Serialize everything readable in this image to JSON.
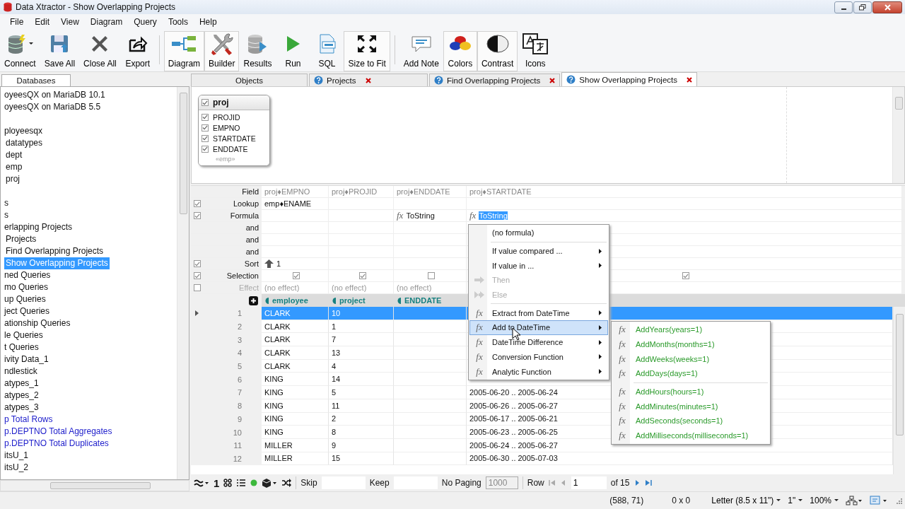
{
  "window": {
    "title": "Data Xtractor - Show Overlapping Projects"
  },
  "menu": [
    "File",
    "Edit",
    "View",
    "Diagram",
    "Query",
    "Tools",
    "Help"
  ],
  "toolbar": [
    [
      {
        "label": "Connect",
        "on": false,
        "dropdown": true
      },
      {
        "label": "Save All",
        "on": false,
        "dropdown": false
      },
      {
        "label": "Close All",
        "on": false,
        "dropdown": false
      },
      {
        "label": "Export",
        "on": false,
        "dropdown": false
      }
    ],
    [
      {
        "label": "Diagram",
        "on": true,
        "dropdown": false
      },
      {
        "label": "Builder",
        "on": true,
        "dropdown": false
      },
      {
        "label": "Results",
        "on": false,
        "dropdown": false
      },
      {
        "label": "Run",
        "on": false,
        "dropdown": false
      },
      {
        "label": "SQL",
        "on": false,
        "dropdown": false
      },
      {
        "label": "Size to Fit",
        "on": true,
        "dropdown": false
      }
    ],
    [
      {
        "label": "Add Note",
        "on": false,
        "dropdown": false
      },
      {
        "label": "Colors",
        "on": true,
        "dropdown": false
      },
      {
        "label": "Contrast",
        "on": true,
        "dropdown": false
      },
      {
        "label": "Icons",
        "on": false,
        "dropdown": false
      }
    ]
  ],
  "sidebar": {
    "tab": "Databases",
    "sections": [
      [
        {
          "label": "oyeesQX on MariaDB 10.1",
          "kind": "plain",
          "selected": false
        },
        {
          "label": "oyeesQX on MariaDB 5.5",
          "kind": "plain",
          "selected": false
        }
      ],
      [
        {
          "label": "ployeesqx",
          "kind": "plain",
          "selected": false,
          "children": [
            {
              "label": "datatypes",
              "kind": "plain",
              "selected": false
            },
            {
              "label": "dept",
              "kind": "plain",
              "selected": false
            },
            {
              "label": "emp",
              "kind": "plain",
              "selected": false
            },
            {
              "label": "proj",
              "kind": "plain",
              "selected": false
            }
          ]
        }
      ],
      [
        {
          "label": "s",
          "kind": "plain",
          "selected": false
        },
        {
          "label": "s",
          "kind": "plain",
          "selected": false
        },
        {
          "label": "erlapping Projects",
          "kind": "plain",
          "selected": false,
          "children": [
            {
              "label": "Projects",
              "kind": "plain",
              "selected": false
            },
            {
              "label": "Find Overlapping Projects",
              "kind": "plain",
              "selected": false
            },
            {
              "label": "Show Overlapping Projects",
              "kind": "plain",
              "selected": true
            }
          ]
        },
        {
          "label": "ned Queries",
          "kind": "plain",
          "selected": false
        },
        {
          "label": "mo Queries",
          "kind": "plain",
          "selected": false
        },
        {
          "label": "up Queries",
          "kind": "plain",
          "selected": false
        },
        {
          "label": "ject Queries",
          "kind": "plain",
          "selected": false
        },
        {
          "label": "ationship Queries",
          "kind": "plain",
          "selected": false
        },
        {
          "label": "le Queries",
          "kind": "plain",
          "selected": false
        },
        {
          "label": "t Queries",
          "kind": "plain",
          "selected": false
        },
        {
          "label": "ivity Data_1",
          "kind": "plain",
          "selected": false
        },
        {
          "label": "ndlestick",
          "kind": "plain",
          "selected": false
        },
        {
          "label": "atypes_1",
          "kind": "plain",
          "selected": false
        },
        {
          "label": "atypes_2",
          "kind": "plain",
          "selected": false
        },
        {
          "label": "atypes_3",
          "kind": "plain",
          "selected": false
        },
        {
          "label": "p Total Rows",
          "kind": "total",
          "selected": false
        },
        {
          "label": "p.DEPTNO Total Aggregates",
          "kind": "total",
          "selected": false
        },
        {
          "label": "p.DEPTNO Total Duplicates",
          "kind": "total",
          "selected": false
        },
        {
          "label": "itsU_1",
          "kind": "plain",
          "selected": false
        },
        {
          "label": "itsU_2",
          "kind": "plain",
          "selected": false
        }
      ]
    ]
  },
  "tabs": [
    {
      "label": "Objects",
      "selected": false,
      "closable": false
    },
    {
      "label": "Projects",
      "selected": false,
      "closable": true
    },
    {
      "label": "Find Overlapping Projects",
      "selected": false,
      "closable": true
    },
    {
      "label": "Show Overlapping Projects",
      "selected": true,
      "closable": true
    }
  ],
  "diagram": {
    "table": {
      "name": "proj",
      "checked": true,
      "fields": [
        {
          "name": "PROJID",
          "checked": true
        },
        {
          "name": "EMPNO",
          "checked": true
        },
        {
          "name": "STARTDATE",
          "checked": true
        },
        {
          "name": "ENDDATE",
          "checked": true
        }
      ],
      "footer": "«emp»"
    }
  },
  "query_grid": {
    "rows": [
      {
        "label": "Field",
        "kind": "header",
        "disabled": false,
        "cells": [
          {
            "text": "proj♦EMPNO"
          },
          {
            "text": "proj♦PROJID"
          },
          {
            "text": "proj♦ENDDATE"
          },
          {
            "text": "proj♦STARTDATE"
          }
        ]
      },
      {
        "label": "Lookup",
        "kind": "text",
        "checked": true,
        "disabled": false,
        "cells": [
          {
            "text": "emp♦ENAME"
          },
          {},
          {},
          {}
        ]
      },
      {
        "label": "Formula",
        "kind": "formula",
        "checked": true,
        "disabled": false,
        "cells": [
          {},
          {},
          {
            "glyph": "fx",
            "text": "ToString",
            "selected": false
          },
          {
            "glyph": "fx",
            "text": "ToString",
            "selected": true
          }
        ]
      },
      {
        "label": "and",
        "kind": "text",
        "disabled": false,
        "cells": [
          {},
          {},
          {},
          {}
        ]
      },
      {
        "label": "and",
        "kind": "text",
        "disabled": false,
        "cells": [
          {},
          {},
          {},
          {}
        ]
      },
      {
        "label": "and",
        "kind": "text",
        "disabled": false,
        "cells": [
          {},
          {},
          {},
          {}
        ]
      },
      {
        "label": "Sort",
        "kind": "sort",
        "checked": true,
        "disabled": false,
        "cells": [
          {
            "text": "1",
            "ascending": true
          },
          {},
          {},
          {}
        ]
      },
      {
        "label": "Selection",
        "kind": "checkbox",
        "checked": true,
        "disabled": false,
        "cells": [
          {
            "checked": true
          },
          {
            "checked": true
          },
          {
            "checked": false
          },
          {
            "checked": true
          }
        ]
      },
      {
        "label": "Effect",
        "kind": "muted",
        "checked": false,
        "disabled": true,
        "cells": [
          {
            "text": "(no effect)"
          },
          {
            "text": "(no effect)"
          },
          {
            "text": "(no effect)"
          },
          {}
        ]
      }
    ]
  },
  "results": {
    "columns": [
      "employee",
      "project",
      "ENDDATE"
    ],
    "rows": [
      {
        "n": "1",
        "employee": "CLARK",
        "project": "10",
        "selected": true
      },
      {
        "n": "2",
        "employee": "CLARK",
        "project": "1",
        "selected": false
      },
      {
        "n": "3",
        "employee": "CLARK",
        "project": "7",
        "selected": false
      },
      {
        "n": "4",
        "employee": "CLARK",
        "project": "13",
        "selected": false
      },
      {
        "n": "5",
        "employee": "CLARK",
        "project": "4",
        "selected": false
      },
      {
        "n": "6",
        "employee": "KING",
        "project": "14",
        "selected": false
      },
      {
        "n": "7",
        "employee": "KING",
        "project": "5",
        "startdate": "2005-06-20 .. 2005-06-24",
        "selected": false
      },
      {
        "n": "8",
        "employee": "KING",
        "project": "11",
        "startdate": "2005-06-26 .. 2005-06-27",
        "selected": false
      },
      {
        "n": "9",
        "employee": "KING",
        "project": "2",
        "startdate": "2005-06-17 .. 2005-06-21",
        "selected": false
      },
      {
        "n": "10",
        "employee": "KING",
        "project": "8",
        "startdate": "2005-06-23 .. 2005-06-25",
        "selected": false
      },
      {
        "n": "11",
        "employee": "MILLER",
        "project": "9",
        "startdate": "2005-06-24 .. 2005-06-27",
        "selected": false
      },
      {
        "n": "12",
        "employee": "MILLER",
        "project": "15",
        "startdate": "2005-06-30 .. 2005-07-03",
        "selected": false
      }
    ]
  },
  "context_menu": {
    "items": [
      {
        "kind": "plain",
        "label": "(no formula)",
        "submenu": false,
        "disabled": false,
        "selected": false
      },
      {
        "kind": "separator"
      },
      {
        "kind": "plain",
        "label": "If value compared ...",
        "submenu": true,
        "disabled": false,
        "selected": false
      },
      {
        "kind": "plain",
        "label": "If value in ...",
        "submenu": true,
        "disabled": false,
        "selected": false
      },
      {
        "kind": "then",
        "label": "Then",
        "submenu": false,
        "disabled": true,
        "selected": false
      },
      {
        "kind": "else",
        "label": "Else",
        "submenu": false,
        "disabled": true,
        "selected": false
      },
      {
        "kind": "separator"
      },
      {
        "kind": "function",
        "glyph": "fx",
        "label": "Extract from DateTime",
        "submenu": true,
        "disabled": false,
        "selected": false
      },
      {
        "kind": "function",
        "glyph": "fx",
        "label": "Add to DateTime",
        "submenu": true,
        "disabled": false,
        "selected": true
      },
      {
        "kind": "function",
        "glyph": "fx",
        "label": "DateTime Difference",
        "submenu": true,
        "disabled": false,
        "selected": false
      },
      {
        "kind": "function",
        "glyph": "fx",
        "label": "Conversion Function",
        "submenu": true,
        "disabled": false,
        "selected": false
      },
      {
        "kind": "function",
        "glyph": "fx",
        "label": "Analytic Function",
        "submenu": true,
        "disabled": false,
        "selected": false
      }
    ],
    "submenu": [
      {
        "kind": "function",
        "glyph": "fx",
        "label": "AddYears(years=1)"
      },
      {
        "kind": "function",
        "glyph": "fx",
        "label": "AddMonths(months=1)"
      },
      {
        "kind": "function",
        "glyph": "fx",
        "label": "AddWeeks(weeks=1)"
      },
      {
        "kind": "function",
        "glyph": "fx",
        "label": "AddDays(days=1)"
      },
      {
        "kind": "separator"
      },
      {
        "kind": "function",
        "glyph": "fx",
        "label": "AddHours(hours=1)"
      },
      {
        "kind": "function",
        "glyph": "fx",
        "label": "AddMinutes(minutes=1)"
      },
      {
        "kind": "function",
        "glyph": "fx",
        "label": "AddSeconds(seconds=1)"
      },
      {
        "kind": "function",
        "glyph": "fx",
        "label": "AddMilliseconds(milliseconds=1)"
      }
    ]
  },
  "paging": {
    "record": "1",
    "skip": "Skip",
    "keep": "Keep",
    "no_paging": "No Paging",
    "page_size": "1000",
    "row": "Row",
    "row_value": "1",
    "row_total": "of 15"
  },
  "status_bar": {
    "position": "(588, 71)",
    "size": "0 x 0",
    "paper": "Letter (8.5 x 11\")",
    "margin": "1\"",
    "zoom": "100%"
  }
}
